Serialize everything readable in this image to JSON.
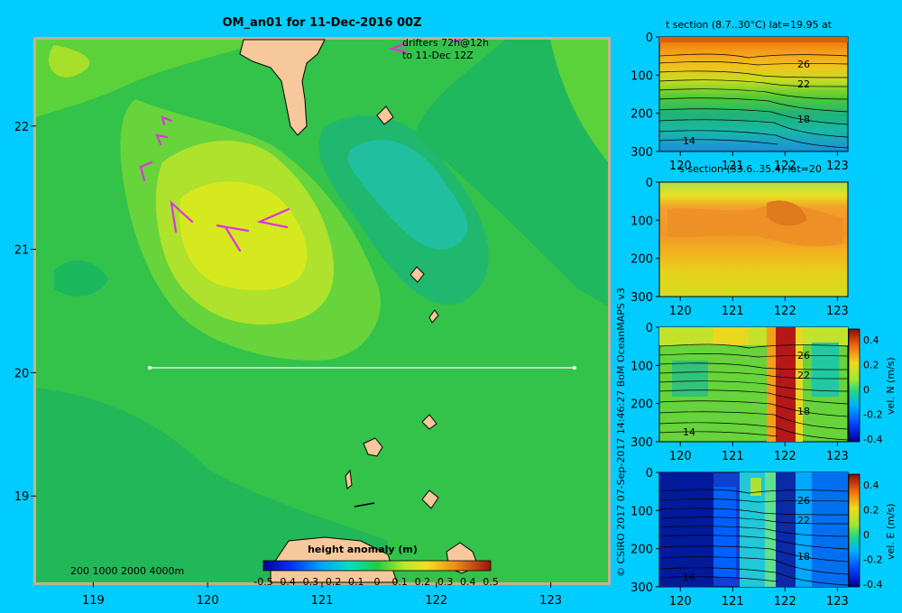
{
  "colors": {
    "background": "#00ccff",
    "frame": "#c8b08c",
    "land": "#f7c89b",
    "drifter": "#dd33dd",
    "transect": "#ffffff"
  },
  "map": {
    "title": "OM_an01 for 11-Dec-2016 00Z",
    "drifter_note_line1": "drifters 72h@12h",
    "drifter_note_line2": "to 11-Dec 12Z",
    "depth_legend": "200  1000  2000  4000m",
    "credit": "© CSIRO 2017   07-Sep-2017 14:46:27 BoM OceanMAPS v3",
    "colorbar_title": "height anomaly (m)",
    "colorbar_ticks": [
      "-0.5",
      "-0.4",
      "-0.3",
      "-0.2",
      "-0.1",
      "0",
      "0.1",
      "0.2",
      "0.3",
      "0.4",
      "0.5"
    ],
    "x_ticks": [
      "119",
      "120",
      "121",
      "122",
      "123"
    ],
    "y_ticks": [
      "22",
      "21",
      "20",
      "19"
    ]
  },
  "panels": [
    {
      "title": "t section (8.7..30°C) lat=19.95 at",
      "isotherms": [
        "26",
        "22",
        "18",
        "14"
      ],
      "colorbar": null
    },
    {
      "title": "s section (33.6..35.4) lat=20",
      "isotherms": [],
      "colorbar": null
    },
    {
      "title": "",
      "isotherms": [
        "26",
        "22",
        "18",
        "14"
      ],
      "colorbar": {
        "label": "vel. N (m/s)",
        "ticks": [
          "0.4",
          "0.2",
          "0",
          "-0.2",
          "-0.4"
        ]
      }
    },
    {
      "title": "",
      "isotherms": [
        "26",
        "22",
        "18",
        "14"
      ],
      "colorbar": {
        "label": "vel. E (m/s)",
        "ticks": [
          "0.4",
          "0.2",
          "0",
          "-0.2",
          "-0.4"
        ]
      }
    }
  ],
  "section_axes": {
    "x_ticks": [
      "120",
      "121",
      "122",
      "123"
    ],
    "y_ticks": [
      "0",
      "100",
      "200",
      "300"
    ]
  },
  "chart_data": [
    {
      "type": "heatmap",
      "title": "OM_an01 for 11-Dec-2016 00Z",
      "xlim": [
        118.5,
        123.5
      ],
      "ylim": [
        18.3,
        22.7
      ],
      "x_ticks": [
        119,
        120,
        121,
        122,
        123
      ],
      "y_ticks": [
        19,
        20,
        21,
        22
      ],
      "colorbar": {
        "label": "height anomaly (m)",
        "range": [
          -0.5,
          0.5
        ]
      },
      "transect": {
        "lat": 20,
        "lon_range": [
          119.5,
          123.2
        ]
      },
      "anomaly_max": {
        "lon": 120.3,
        "lat": 21.0,
        "value": 0.15
      }
    },
    {
      "type": "heatmap",
      "title": "t section (8.7..30°C) lat=19.95 at",
      "xlim": [
        119.6,
        123.2
      ],
      "ylim": [
        300,
        0
      ],
      "contour_labels": [
        26,
        22,
        18,
        14
      ]
    },
    {
      "type": "heatmap",
      "title": "s section (33.6..35.4) lat=20",
      "xlim": [
        119.6,
        123.2
      ],
      "ylim": [
        300,
        0
      ]
    },
    {
      "type": "heatmap",
      "title": "",
      "xlim": [
        119.6,
        123.2
      ],
      "ylim": [
        300,
        0
      ],
      "colorbar": {
        "label": "vel. N (m/s)",
        "range": [
          -0.4,
          0.4
        ]
      }
    },
    {
      "type": "heatmap",
      "title": "",
      "xlim": [
        119.6,
        123.2
      ],
      "ylim": [
        300,
        0
      ],
      "colorbar": {
        "label": "vel. E (m/s)",
        "range": [
          -0.4,
          0.4
        ]
      }
    }
  ]
}
